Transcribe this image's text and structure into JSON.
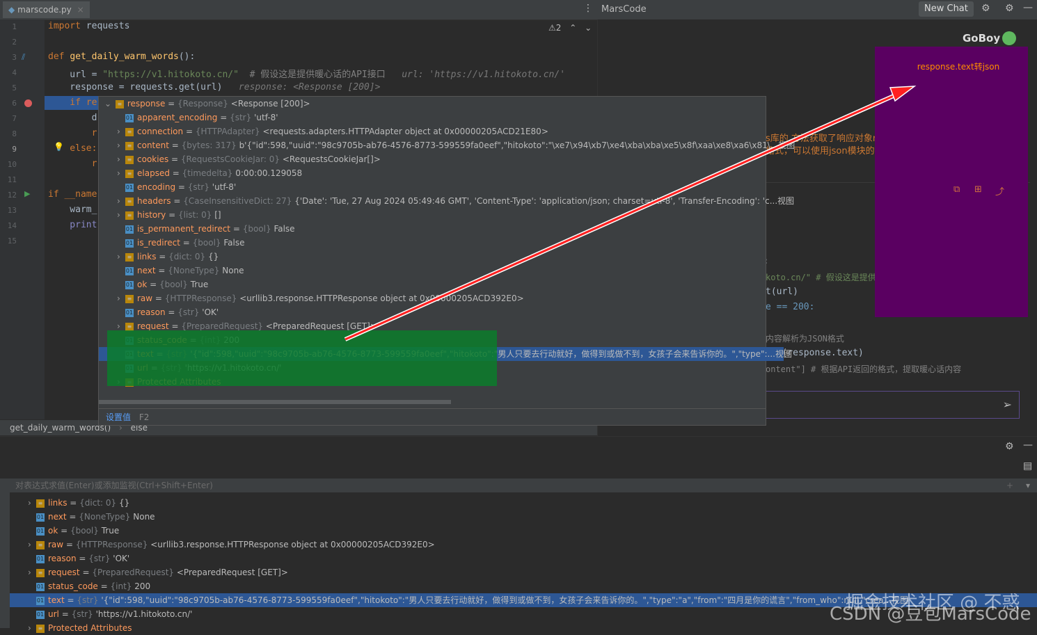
{
  "editor": {
    "tab_label": "marscode.py",
    "warning_count": "2",
    "lines": [
      "1",
      "2",
      "3",
      "4",
      "5",
      "6",
      "7",
      "8",
      "9",
      "10",
      "11",
      "12",
      "13",
      "14",
      "15"
    ],
    "code": {
      "l1_kw": "import",
      "l1_rest": " requests",
      "l3_kw": "def",
      "l3_fn": "get_daily_warm_words",
      "l3_rest": "():",
      "l4_a": "    url = ",
      "l4_str": "\"https://v1.hitokoto.cn/\"",
      "l4_cmt": "  # 假设这是提供暖心话的API接口",
      "l4_hint": "   url: 'https://v1.hitokoto.cn/'",
      "l5_a": "    response = requests.get(url)",
      "l5_hint": "   response: <Response [200]>",
      "l6": "    if re",
      "l7": "        d",
      "l8": "        r",
      "l9": "    else:",
      "l10": "        r",
      "l12": "if __name",
      "l13": "    warm_",
      "l14": "    print"
    },
    "breadcrumb": [
      "get_daily_warm_words()",
      "else"
    ]
  },
  "popup": {
    "root": {
      "name": "response",
      "type": "{Response}",
      "value": "<Response [200]>"
    },
    "rows": [
      {
        "name": "apparent_encoding",
        "type": "{str}",
        "value": "'utf-8'",
        "expandable": false
      },
      {
        "name": "connection",
        "type": "{HTTPAdapter}",
        "value": "<requests.adapters.HTTPAdapter object at 0x00000205ACD21E80>",
        "expandable": true
      },
      {
        "name": "content",
        "type": "{bytes: 317}",
        "value": "b'{\"id\":598,\"uuid\":\"98c9705b-ab76-4576-8773-599559fa0eef\",\"hitokoto\":\"\\xe7\\x94\\xb7\\xe4\\xba\\xba\\xe5\\x8f\\xaa\\xe8\\xa6\\x81\\...视图",
        "expandable": true
      },
      {
        "name": "cookies",
        "type": "{RequestsCookieJar: 0}",
        "value": "<RequestsCookieJar[]>",
        "expandable": true
      },
      {
        "name": "elapsed",
        "type": "{timedelta}",
        "value": "0:00:00.129058",
        "expandable": true
      },
      {
        "name": "encoding",
        "type": "{str}",
        "value": "'utf-8'",
        "expandable": false
      },
      {
        "name": "headers",
        "type": "{CaseInsensitiveDict: 27}",
        "value": "{'Date': 'Tue, 27 Aug 2024 05:49:46 GMT', 'Content-Type': 'application/json; charset=utf-8', 'Transfer-Encoding': 'c...视图",
        "expandable": true
      },
      {
        "name": "history",
        "type": "{list: 0}",
        "value": "[]",
        "expandable": true
      },
      {
        "name": "is_permanent_redirect",
        "type": "{bool}",
        "value": "False",
        "expandable": false
      },
      {
        "name": "is_redirect",
        "type": "{bool}",
        "value": "False",
        "expandable": false
      },
      {
        "name": "links",
        "type": "{dict: 0}",
        "value": "{}",
        "expandable": true
      },
      {
        "name": "next",
        "type": "{NoneType}",
        "value": "None",
        "expandable": false
      },
      {
        "name": "ok",
        "type": "{bool}",
        "value": "True",
        "expandable": false
      },
      {
        "name": "raw",
        "type": "{HTTPResponse}",
        "value": "<urllib3.response.HTTPResponse object at 0x00000205ACD392E0>",
        "expandable": true
      },
      {
        "name": "reason",
        "type": "{str}",
        "value": "'OK'",
        "expandable": false
      },
      {
        "name": "request",
        "type": "{PreparedRequest}",
        "value": "<PreparedRequest [GET]>",
        "expandable": true
      },
      {
        "name": "status_code",
        "type": "{int}",
        "value": "200",
        "expandable": false
      },
      {
        "name": "text",
        "type": "{str}",
        "value": "'{\"id\":598,\"uuid\":\"98c9705b-ab76-4576-8773-599559fa0eef\",\"hitokoto\":\"男人只要去行动就好，做得到或做不到，女孩子会来告诉你的。\",\"type\":...视图",
        "expandable": false
      },
      {
        "name": "url",
        "type": "{str}",
        "value": "'https://v1.hitokoto.cn/'",
        "expandable": false
      },
      {
        "name": "Protected Attributes",
        "type": "",
        "value": "",
        "expandable": true
      }
    ],
    "footer_action": "设置值",
    "footer_key": "F2"
  },
  "chat": {
    "title": "MarsCode",
    "new_chat": "New Chat",
    "user": "GoBoy",
    "user_message": "response.text转json",
    "answer_line1": "s库的   方法获取了响应对象response，并且想要将响应",
    "answer_line2": "格式，可以使用json模块的loads函数。下面是修改后的",
    "code1": "koto.cn/\"  # 假设这是提供暖心话的API接口",
    "code2": "t(url)",
    "code3": "e == 200:",
    "code4": "内容解析为JSON格式",
    "code5": "ads(response.text)",
    "code6": "ontent\"]  # 根据API返回的格式，提取暖心话内容",
    "code_colon": ":"
  },
  "debug": {
    "eval_placeholder": "对表达式求值(Enter)或添加监视(Ctrl+Shift+Enter)",
    "rows": [
      {
        "name": "links",
        "type": "{dict: 0}",
        "value": "{}",
        "expandable": true
      },
      {
        "name": "next",
        "type": "{NoneType}",
        "value": "None",
        "expandable": false
      },
      {
        "name": "ok",
        "type": "{bool}",
        "value": "True",
        "expandable": false
      },
      {
        "name": "raw",
        "type": "{HTTPResponse}",
        "value": "<urllib3.response.HTTPResponse object at 0x00000205ACD392E0>",
        "expandable": true
      },
      {
        "name": "reason",
        "type": "{str}",
        "value": "'OK'",
        "expandable": false
      },
      {
        "name": "request",
        "type": "{PreparedRequest}",
        "value": "<PreparedRequest [GET]>",
        "expandable": true
      },
      {
        "name": "status_code",
        "type": "{int}",
        "value": "200",
        "expandable": false
      },
      {
        "name": "text",
        "type": "{str}",
        "value": "'{\"id\":598,\"uuid\":\"98c9705b-ab76-4576-8773-599559fa0eef\",\"hitokoto\":\"男人只要去行动就好，做得到或做不到，女孩子会来告诉你的。\",\"type\":\"a\",\"from\":\"四月是你的谎言\",\"from_who\":null,\"crea...视图",
        "expandable": false
      },
      {
        "name": "url",
        "type": "{str}",
        "value": "'https://v1.hitokoto.cn/'",
        "expandable": false
      },
      {
        "name": "Protected Attributes",
        "type": "",
        "value": "",
        "expandable": true
      }
    ],
    "watermark": "CSDN @豆包MarsCode",
    "watermark2": "掘金技术社区 @ 不惑"
  },
  "colors": {
    "accent": "#2d5795",
    "highlight_green": "#0b7d2b",
    "chat_bubble": "#5a0061",
    "arrow": "#ff2020"
  }
}
